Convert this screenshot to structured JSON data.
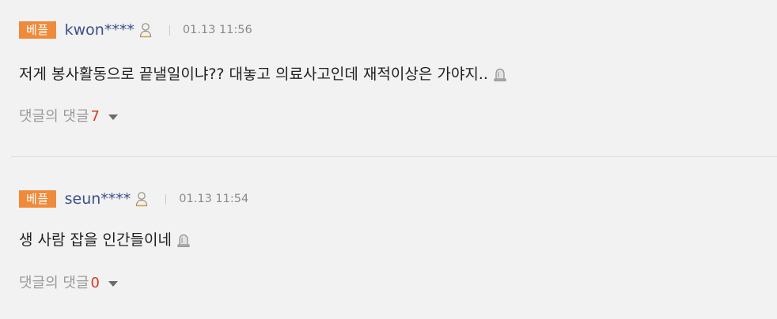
{
  "comments": [
    {
      "badge": "베플",
      "user": "kwon****",
      "time": "01.13 11:56",
      "text": "저게 봉사활동으로 끝낼일이냐?? 대놓고 의료사고인데 재적이상은 가야지..",
      "replies_label": "댓글의 댓글",
      "reply_count": "7"
    },
    {
      "badge": "베플",
      "user": "seun****",
      "time": "01.13 11:54",
      "text": "생 사람 잡을 인간들이네",
      "replies_label": "댓글의 댓글",
      "reply_count": "0"
    }
  ],
  "colors": {
    "badge_bg": "#ef8a3a",
    "username": "#3b4f8c",
    "reply_count": "#d83a23",
    "background": "#f2f2f2"
  },
  "icons": {
    "user": "user-icon",
    "report": "report-siren-icon",
    "expand": "caret-down-icon"
  }
}
